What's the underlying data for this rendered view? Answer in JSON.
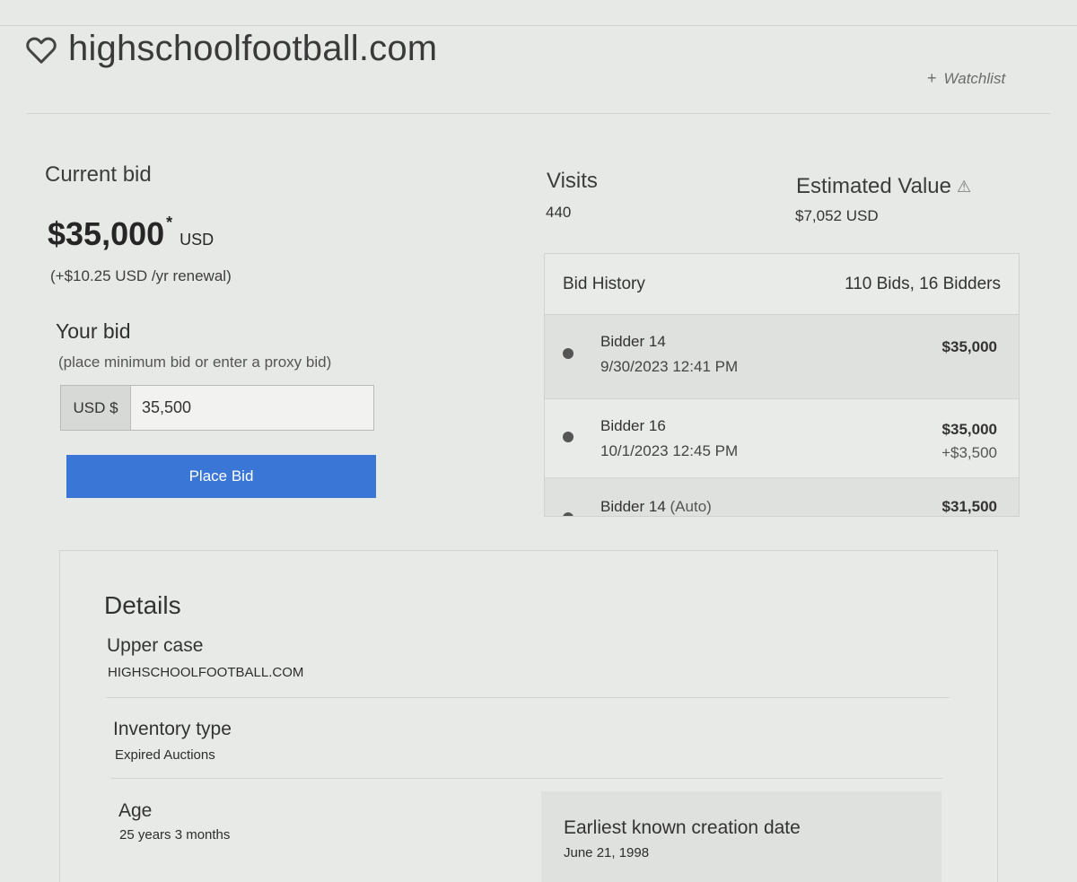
{
  "domain": {
    "name": "highschoolfootball.com"
  },
  "watchlist": {
    "label": "Watchlist"
  },
  "current_bid": {
    "label": "Current bid",
    "amount": "$35,000",
    "marker": "*",
    "unit": "USD",
    "renewal": "(+$10.25 USD /yr renewal)"
  },
  "your_bid": {
    "label": "Your bid",
    "hint": "(place minimum bid or enter a proxy bid)",
    "currency": "USD $",
    "value": "35,500",
    "button": "Place Bid"
  },
  "visits": {
    "label": "Visits",
    "value": "440"
  },
  "estimated_value": {
    "label": "Estimated Value",
    "value": "$7,052 USD"
  },
  "bid_history": {
    "title": "Bid History",
    "summary": "110 Bids, 16 Bidders",
    "rows": [
      {
        "bidder": "Bidder 14",
        "date": "9/30/2023 12:41 PM",
        "amount": "$35,000",
        "increment": ""
      },
      {
        "bidder": "Bidder 16",
        "date": "10/1/2023 12:45 PM",
        "amount": "$35,000",
        "increment": "+$3,500"
      },
      {
        "bidder": "Bidder 14",
        "suffix": "(Auto)",
        "date": "",
        "amount": "$31,500",
        "increment": ""
      }
    ]
  },
  "details": {
    "title": "Details",
    "upper_case": {
      "label": "Upper case",
      "value": "HIGHSCHOOLFOOTBALL.COM"
    },
    "inventory_type": {
      "label": "Inventory type",
      "value": "Expired Auctions"
    },
    "age": {
      "label": "Age",
      "value": "25 years 3 months"
    },
    "creation_date": {
      "label": "Earliest known creation date",
      "value": "June 21, 1998"
    }
  }
}
